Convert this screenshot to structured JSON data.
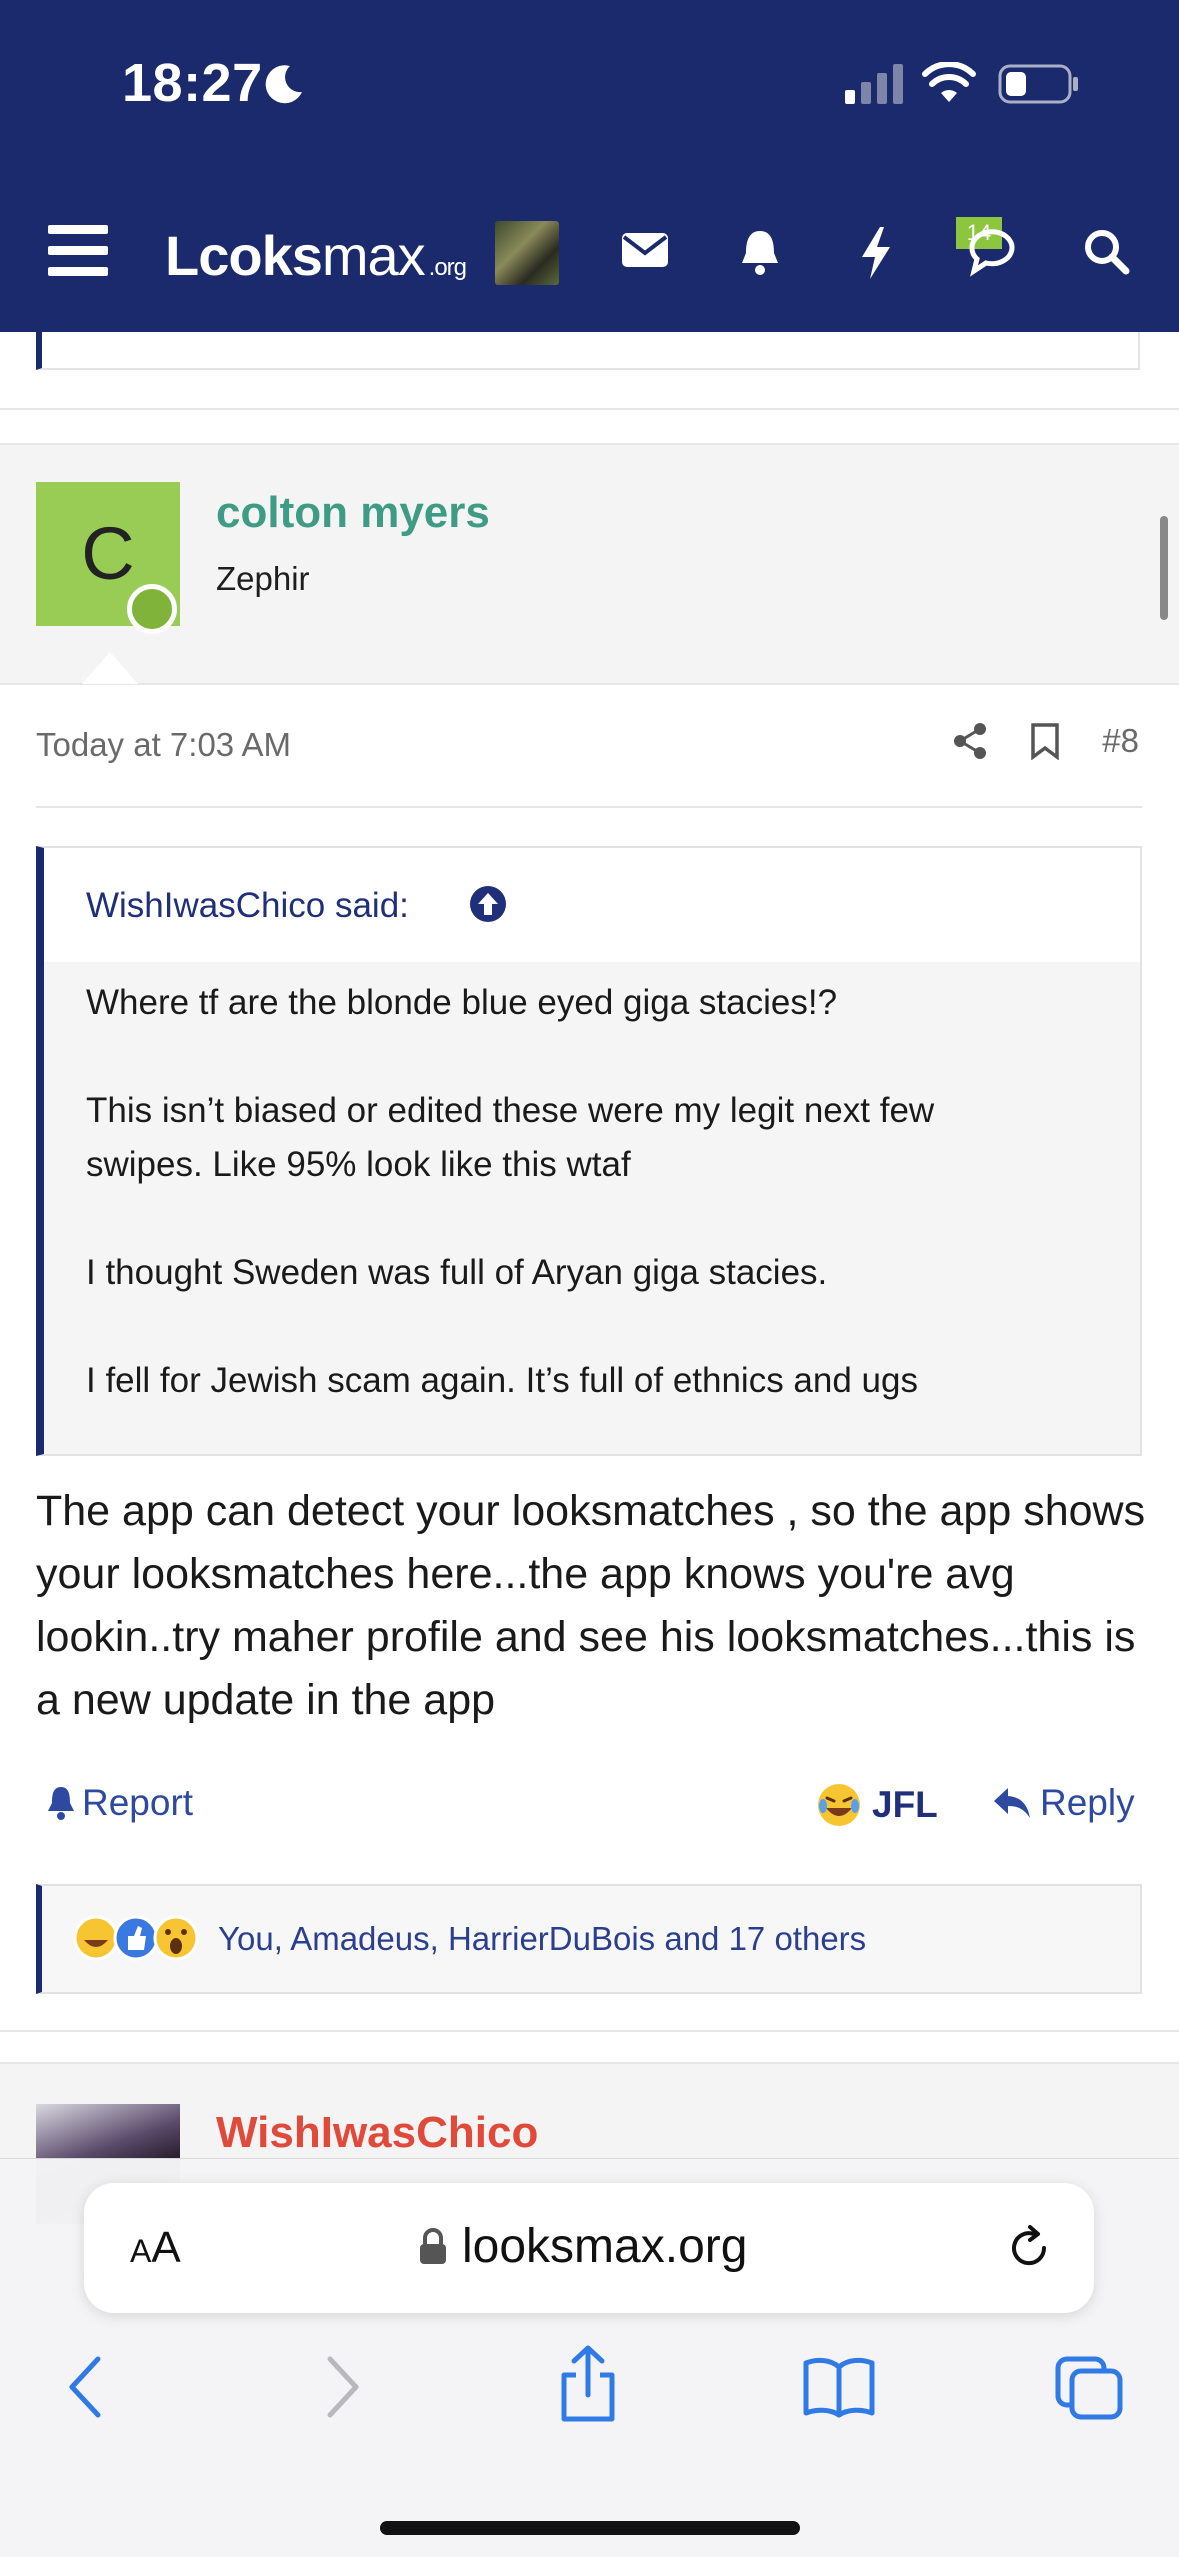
{
  "status": {
    "time": "18:27"
  },
  "header": {
    "logo_main": "Lc",
    "logo_mid": "oks",
    "logo_tail": "max",
    "logo_org": ".org",
    "notification_count": "14"
  },
  "post": {
    "author": "colton myers",
    "avatar_letter": "C",
    "user_title": "Zephir",
    "date": "Today at 7:03 AM",
    "number": "#8",
    "quote": {
      "attribution": "WishIwasChico said:",
      "lines": [
        "Where tf are the blonde blue eyed giga stacies!?",
        "This isn’t biased or edited these were my legit next few",
        "swipes. Like 95% look like this wtaf",
        "I thought Sweden was full of Aryan giga stacies.",
        "I fell for Jewish scam again. It’s full of ethnics and ugs"
      ]
    },
    "body": "The app can detect your looksmatches , so the app shows your looksmatches here...the app knows you're avg lookin..try maher profile and see his looksmatches...this is a new update in the app",
    "actions": {
      "report": "Report",
      "jfl": "JFL",
      "reply": "Reply"
    },
    "reactions_text": "You, Amadeus, HarrierDuBois and 17 others"
  },
  "next_post": {
    "author": "WishIwasChico"
  },
  "browser": {
    "aa_big": "A",
    "aa_small": "A",
    "url": "looksmax.org"
  },
  "colors": {
    "header": "#1a2a6c",
    "username": "#3e9c85",
    "link": "#2d4aa0",
    "next_username": "#e04a3a"
  }
}
